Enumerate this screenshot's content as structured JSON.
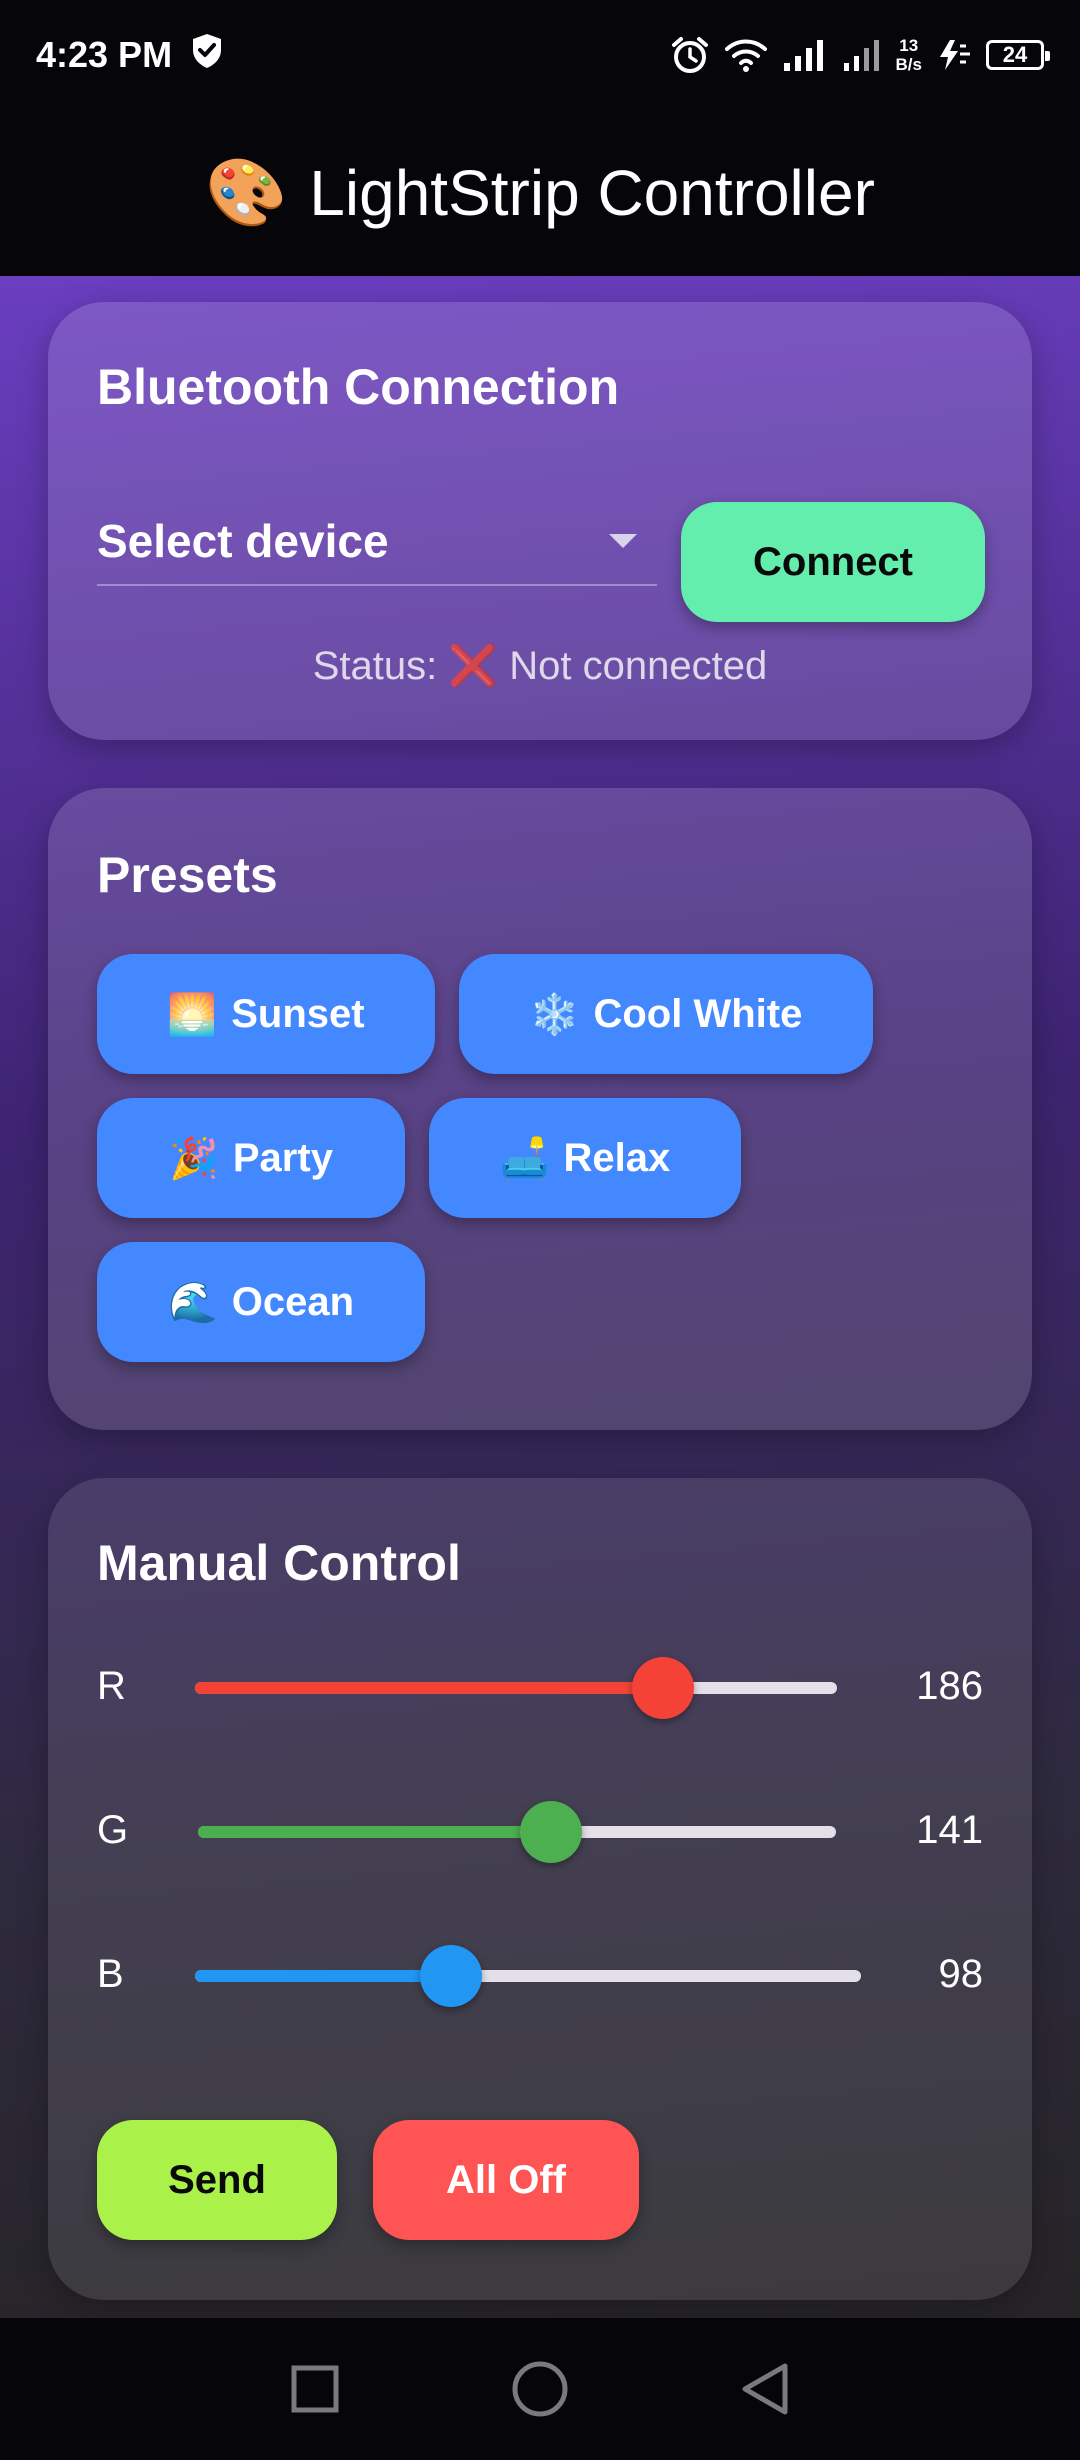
{
  "status_bar": {
    "time": "4:23 PM",
    "net_speed_value": "13",
    "net_speed_unit": "B/s",
    "battery": "24",
    "icons": [
      "shield-icon",
      "alarm-icon",
      "wifi-icon",
      "signal-icon",
      "signal-icon",
      "charging-icon",
      "battery-icon"
    ]
  },
  "app_bar": {
    "icon": "🎨",
    "title": "LightStrip Controller"
  },
  "bluetooth": {
    "title": "Bluetooth Connection",
    "device_select": "Select device",
    "connect_label": "Connect",
    "status_text": "Status: ❌ Not connected"
  },
  "presets": {
    "title": "Presets",
    "items": [
      {
        "emoji": "🌅",
        "label": "Sunset"
      },
      {
        "emoji": "❄️",
        "label": "Cool White"
      },
      {
        "emoji": "🎉",
        "label": "Party"
      },
      {
        "emoji": "🛋️",
        "label": "Relax"
      },
      {
        "emoji": "🌊",
        "label": "Ocean"
      }
    ]
  },
  "manual": {
    "title": "Manual Control",
    "sliders": [
      {
        "label": "R",
        "value": 186,
        "max": 255,
        "color": "#f44336"
      },
      {
        "label": "G",
        "value": 141,
        "max": 255,
        "color": "#4caf50"
      },
      {
        "label": "B",
        "value": 98,
        "max": 255,
        "color": "#2196f3"
      }
    ],
    "send_label": "Send",
    "off_label": "All Off"
  },
  "colors": {
    "connect": "#63eead",
    "preset": "#4488ff",
    "send": "#aaf24a",
    "all_off": "#ff5454"
  },
  "nav_bar": {
    "icons": [
      "recents-square-icon",
      "home-circle-icon",
      "back-triangle-icon"
    ]
  }
}
